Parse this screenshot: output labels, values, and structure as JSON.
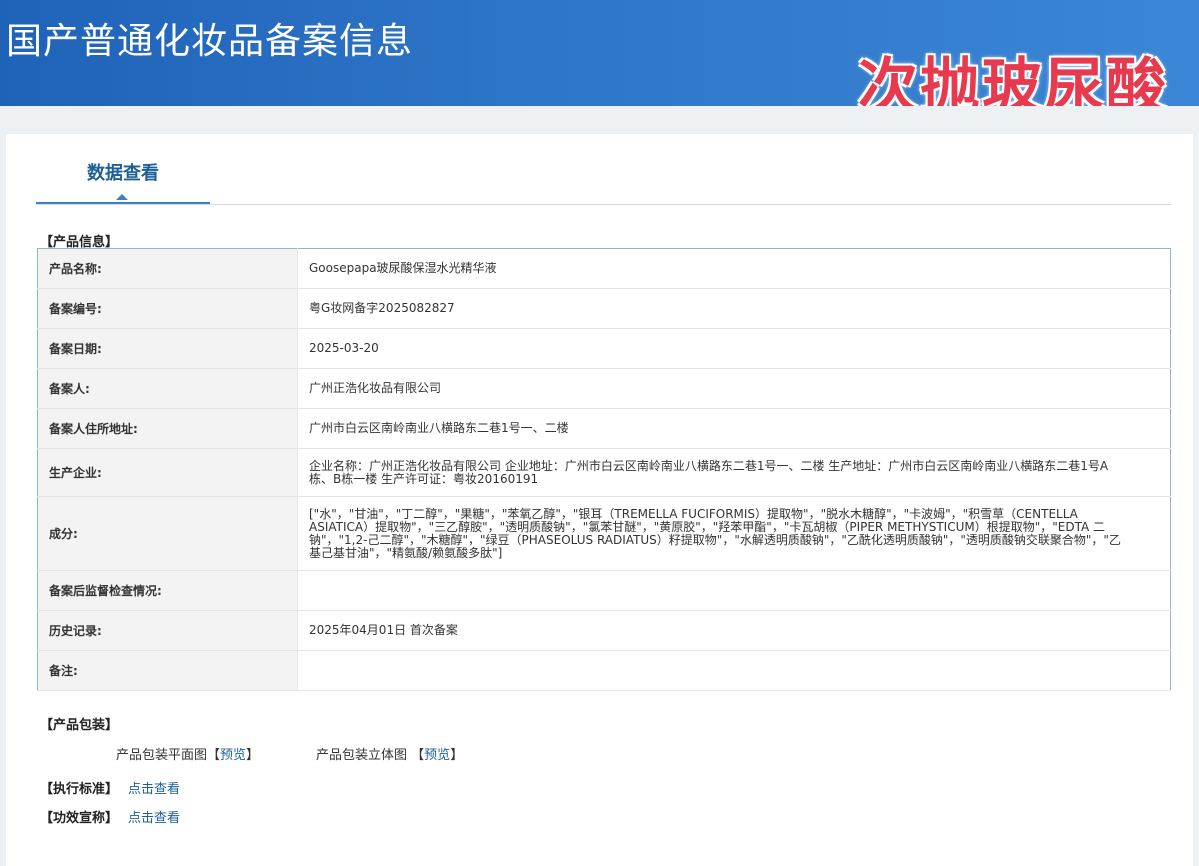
{
  "header": {
    "title": "国产普通化妆品备案信息",
    "stamp_text": "次抛玻尿酸"
  },
  "tabs": {
    "active_label": "数据查看"
  },
  "product_info": {
    "section_title": "【产品信息】",
    "rows": [
      {
        "label": "产品名称:",
        "value": "Goosepapa玻尿酸保湿水光精华液"
      },
      {
        "label": "备案编号:",
        "value": "粤G妆网备字2025082827"
      },
      {
        "label": "备案日期:",
        "value": "2025-03-20"
      },
      {
        "label": "备案人:",
        "value": "广州正浩化妆品有限公司"
      },
      {
        "label": "备案人住所地址:",
        "value": "广州市白云区南岭南业八横路东二巷1号一、二楼"
      },
      {
        "label": "生产企业:",
        "value": "企业名称：广州正浩化妆品有限公司 企业地址：广州市白云区南岭南业八横路东二巷1号一、二楼 生产地址：广州市白云区南岭南业八横路东二巷1号A栋、B栋一楼 生产许可证：粤妆20160191"
      },
      {
        "label": "成分:",
        "value": "[\"水\"，\"甘油\"，\"丁二醇\"，\"果糖\"，\"苯氧乙醇\"，\"银耳（TREMELLA FUCIFORMIS）提取物\"，\"脱水木糖醇\"，\"卡波姆\"，\"积雪草（CENTELLA ASIATICA）提取物\"，\"三乙醇胺\"，\"透明质酸钠\"，\"氯苯甘醚\"，\"黄原胶\"，\"羟苯甲酯\"，\"卡瓦胡椒（PIPER METHYSTICUM）根提取物\"，\"EDTA 二钠\"，\"1,2-己二醇\"，\"木糖醇\"，\"绿豆（PHASEOLUS RADIATUS）籽提取物\"，\"水解透明质酸钠\"，\"乙酰化透明质酸钠\"，\"透明质酸钠交联聚合物\"，\"乙基己基甘油\"，\"精氨酸/赖氨酸多肽\"]"
      },
      {
        "label": "备案后监督检查情况:",
        "value": ""
      },
      {
        "label": "历史记录:",
        "value": "2025年04月01日 首次备案"
      },
      {
        "label": "备注:",
        "value": ""
      }
    ]
  },
  "packaging": {
    "section_title": "【产品包装】",
    "flat_label": "产品包装平面图",
    "solid_label": "产品包装立体图",
    "bracket_open": "【",
    "bracket_close": "】",
    "preview_link": "预览"
  },
  "standard": {
    "label": "【执行标准】",
    "link": "点击查看"
  },
  "efficacy": {
    "label": "【功效宣称】",
    "link": "点击查看"
  }
}
